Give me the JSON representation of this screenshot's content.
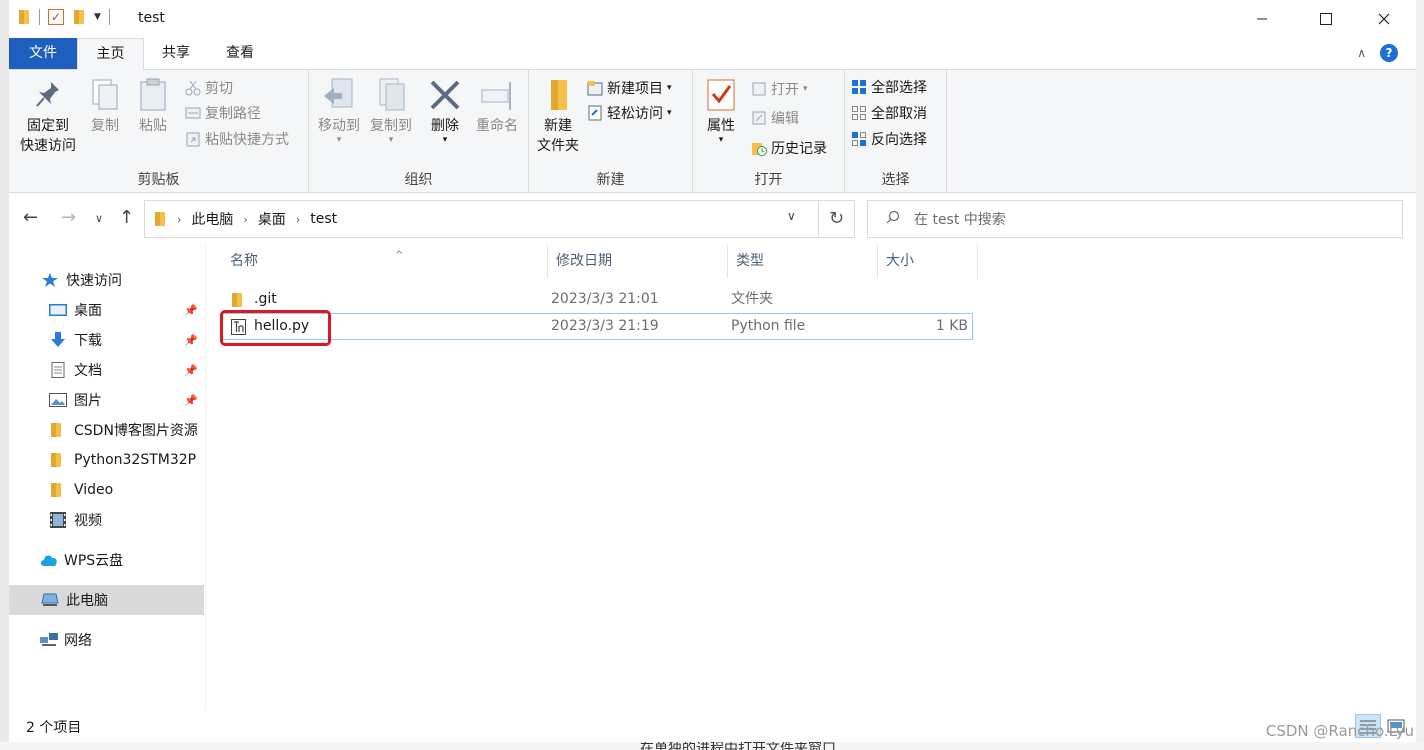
{
  "window": {
    "title": "test"
  },
  "ribbon_tabs": {
    "file": "文件",
    "home": "主页",
    "share": "共享",
    "view": "查看"
  },
  "clipboard": {
    "pin_line1": "固定到",
    "pin_line2": "快速访问",
    "copy": "复制",
    "paste": "粘贴",
    "cut": "剪切",
    "copy_path": "复制路径",
    "paste_shortcut": "粘贴快捷方式",
    "label": "剪贴板"
  },
  "organize": {
    "move_to": "移动到",
    "copy_to": "复制到",
    "delete": "删除",
    "rename": "重命名",
    "label": "组织"
  },
  "new_group": {
    "new_folder_line1": "新建",
    "new_folder_line2": "文件夹",
    "new_item": "新建项目",
    "easy_access": "轻松访问",
    "label": "新建"
  },
  "open_group": {
    "properties": "属性",
    "open": "打开",
    "edit": "编辑",
    "history": "历史记录",
    "label": "打开"
  },
  "select_group": {
    "select_all": "全部选择",
    "select_none": "全部取消",
    "invert": "反向选择",
    "label": "选择"
  },
  "address": {
    "crumbs": [
      "此电脑",
      "桌面",
      "test"
    ]
  },
  "search": {
    "placeholder": "在 test 中搜索"
  },
  "sidebar": {
    "quick_access": "快速访问",
    "items": [
      "桌面",
      "下载",
      "文档",
      "图片",
      "CSDN博客图片资源",
      "Python32STM32P",
      "Video",
      "视频"
    ],
    "wps": "WPS云盘",
    "this_pc": "此电脑",
    "network": "网络"
  },
  "columns": {
    "name": "名称",
    "date": "修改日期",
    "type": "类型",
    "size": "大小"
  },
  "files": [
    {
      "name": ".git",
      "date": "2023/3/3 21:01",
      "type": "文件夹",
      "size": ""
    },
    {
      "name": "hello.py",
      "date": "2023/3/3 21:19",
      "type": "Python file",
      "size": "1 KB"
    }
  ],
  "status": {
    "count": "2 个项目"
  },
  "watermark": "CSDN @Rancho.Lyu",
  "background_text": "在单独的进程中打开文件夹窗口",
  "colors": {
    "file_tab": "#1e5ebf",
    "highlight": "#e0181e",
    "folder": "#f4c04a",
    "selected": "#d9d9d9"
  }
}
